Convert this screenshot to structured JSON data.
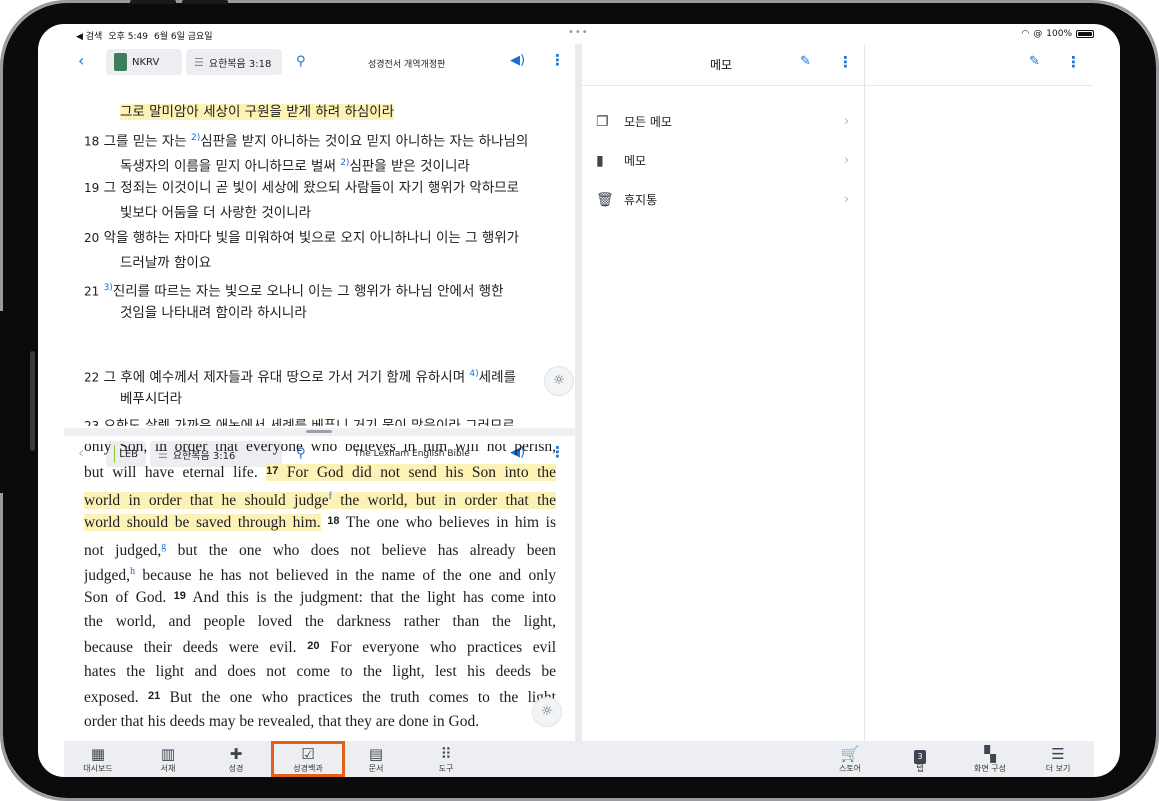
{
  "status": {
    "back_app": "◀ 검색",
    "time": "오후 5:49",
    "date": "6월 6일 금요일",
    "battery": "100%"
  },
  "top_pane": {
    "version": "NKRV",
    "reference": "요한복음 3:18",
    "title": "성경전서 개역개정판",
    "lines": [
      {
        "verse": "",
        "text": "그로 말미암아 세상이 구원을 받게 하려 하심이라",
        "highlight": true
      },
      {
        "verse": "18",
        "pre": "그를 믿는 자는 ",
        "fn": "2)",
        "text": "심판을 받지 아니하는 것이요 믿지 아니하는 자는 하나님의"
      },
      {
        "verse": "",
        "pre": "독생자의 이름을 믿지 아니하므로 벌써 ",
        "fn": "2)",
        "text": "심판을 받은 것이니라"
      },
      {
        "verse": "19",
        "text": "그 정죄는 이것이니 곧 빛이 세상에 왔으되 사람들이 자기 행위가 악하므로"
      },
      {
        "verse": "",
        "text": "빛보다 어둠을 더 사랑한 것이니라"
      },
      {
        "verse": "20",
        "text": "악을 행하는 자마다 빛을 미워하여 빛으로 오지 아니하나니 이는 그 행위가"
      },
      {
        "verse": "",
        "text": "드러날까 함이요"
      },
      {
        "verse": "21",
        "pre": "",
        "fn": "3)",
        "text": "진리를 따르는 자는 빛으로 오나니 이는 그 행위가 하나님 안에서 행한"
      },
      {
        "verse": "",
        "text": "것임을 나타내려 함이라 하시니라"
      },
      {
        "verse": "22",
        "pre": "그 후에 예수께서 제자들과 유대 땅으로 가서 거기 함께 유하시며 ",
        "fn": "4)",
        "text": "세례를"
      },
      {
        "verse": "",
        "text": "베푸시더라"
      },
      {
        "verse": "23",
        "text": "요한도 살렘 가까운 애논에서 세례를 베푸니 거기 물이 많음이라 그러므로"
      }
    ]
  },
  "bottom_pane": {
    "version": "LEB",
    "reference": "요한복음 3:16",
    "title": "The Lexham English Bible",
    "l0": "only Son, in order that everyone who believes in him will not perish,",
    "l1a": "but will have eternal life. ",
    "l1v": "17",
    "l1b": " For God did not send his Son into the",
    "l2a": "world in order that he should judge",
    "l2f": "f",
    "l2b": " the world, but in order that the",
    "l3a": "world should be saved through him.",
    "l3v": "18",
    "l3b": " The one who believes in him is",
    "l4a": "not judged,",
    "l4f": "g",
    "l4b": " but the one who does not believe has already been",
    "l5a": "judged,",
    "l5f": "h",
    "l5b": " because he has not believed in the name of the one and only",
    "l6a": "Son of God. ",
    "l6v": "19",
    "l6b": " And this is the judgment: that the light has come into",
    "l7": "the world, and people loved the darkness rather than the light,",
    "l8a": "because their deeds were evil. ",
    "l8v": "20",
    "l8b": " For everyone who practices evil",
    "l9": "hates the light and does not come to the light, lest his deeds be",
    "l10a": "exposed. ",
    "l10v": "21",
    "l10b": " But the one who practices the truth comes to the light",
    "l11": "order that his deeds may be revealed, that they are done in God."
  },
  "memo": {
    "title": "메모",
    "items": [
      {
        "label": "모든 메모",
        "icon": "stacked-notes-icon"
      },
      {
        "label": "메모",
        "icon": "notebook-icon"
      },
      {
        "label": "휴지통",
        "icon": "trash-icon"
      }
    ]
  },
  "tabbar": {
    "items": [
      {
        "label": "대시보드",
        "icon": "dashboard-icon"
      },
      {
        "label": "서재",
        "icon": "library-icon"
      },
      {
        "label": "성경",
        "icon": "bible-icon"
      },
      {
        "label": "성경백과",
        "icon": "encyclopedia-icon"
      },
      {
        "label": "문서",
        "icon": "document-icon"
      },
      {
        "label": "도구",
        "icon": "tools-grid-icon"
      },
      {
        "label": "스토어",
        "icon": "cart-icon"
      },
      {
        "label": "탭",
        "icon": "tabs-icon",
        "badge": "3"
      },
      {
        "label": "화면 구성",
        "icon": "layout-icon"
      },
      {
        "label": "더 보기",
        "icon": "menu-icon"
      }
    ],
    "active": "성경백과"
  },
  "colors": {
    "accent": "#1a6fd6",
    "highlight": "#fdf2b6",
    "active_tab_border": "#e2611a",
    "tabbar_bg": "#eceef1"
  }
}
